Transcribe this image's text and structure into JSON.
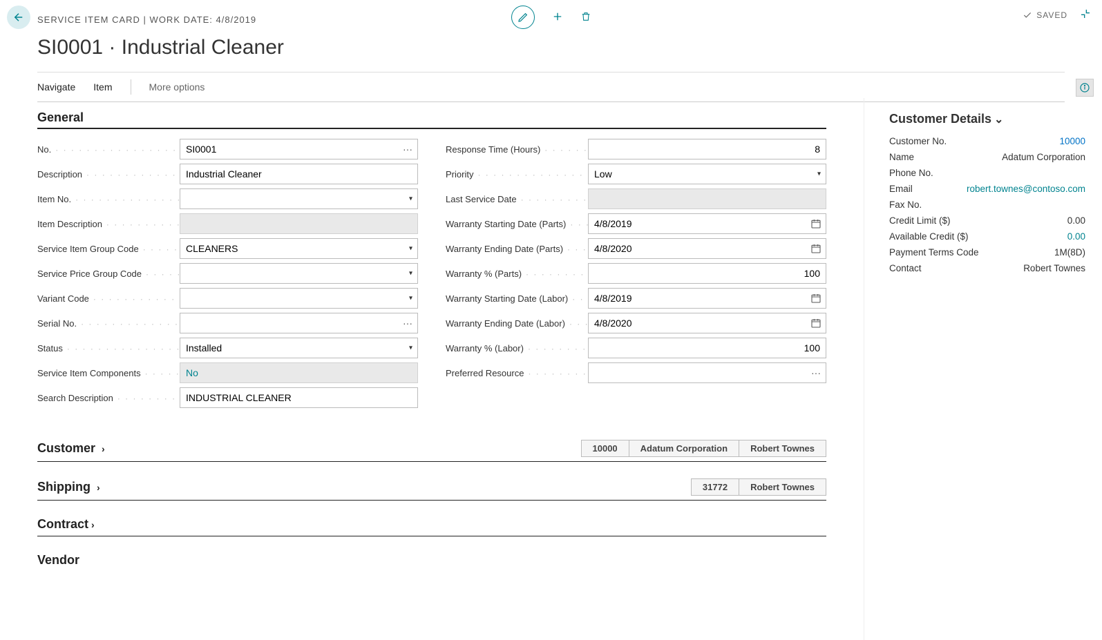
{
  "header": {
    "breadcrumb": "SERVICE ITEM CARD | WORK DATE: 4/8/2019",
    "title": "SI0001 · Industrial Cleaner",
    "saved": "SAVED"
  },
  "actions": {
    "navigate": "Navigate",
    "item": "Item",
    "more": "More options"
  },
  "sections": {
    "general": "General",
    "customer": "Customer",
    "shipping": "Shipping",
    "contract": "Contract",
    "vendor": "Vendor"
  },
  "general": {
    "left": {
      "no_label": "No.",
      "no_value": "SI0001",
      "description_label": "Description",
      "description_value": "Industrial Cleaner",
      "item_no_label": "Item No.",
      "item_no_value": "",
      "item_desc_label": "Item Description",
      "item_desc_value": "",
      "group_label": "Service Item Group Code",
      "group_value": "CLEANERS",
      "price_group_label": "Service Price Group Code",
      "price_group_value": "",
      "variant_label": "Variant Code",
      "variant_value": "",
      "serial_label": "Serial No.",
      "serial_value": "",
      "status_label": "Status",
      "status_value": "Installed",
      "components_label": "Service Item Components",
      "components_value": "No",
      "search_label": "Search Description",
      "search_value": "INDUSTRIAL CLEANER"
    },
    "right": {
      "response_label": "Response Time (Hours)",
      "response_value": "8",
      "priority_label": "Priority",
      "priority_value": "Low",
      "last_service_label": "Last Service Date",
      "last_service_value": "",
      "wsp_label": "Warranty Starting Date (Parts)",
      "wsp_value": "4/8/2019",
      "wep_label": "Warranty Ending Date (Parts)",
      "wep_value": "4/8/2020",
      "wpp_label": "Warranty % (Parts)",
      "wpp_value": "100",
      "wsl_label": "Warranty Starting Date (Labor)",
      "wsl_value": "4/8/2019",
      "wel_label": "Warranty Ending Date (Labor)",
      "wel_value": "4/8/2020",
      "wpl_label": "Warranty % (Labor)",
      "wpl_value": "100",
      "pref_label": "Preferred Resource",
      "pref_value": ""
    }
  },
  "customer_summary": {
    "no": "10000",
    "name": "Adatum Corporation",
    "contact": "Robert Townes"
  },
  "shipping_summary": {
    "code": "31772",
    "contact": "Robert Townes"
  },
  "customer_details": {
    "title": "Customer Details",
    "rows": {
      "customer_no_label": "Customer No.",
      "customer_no_value": "10000",
      "name_label": "Name",
      "name_value": "Adatum Corporation",
      "phone_label": "Phone No.",
      "phone_value": "",
      "email_label": "Email",
      "email_value": "robert.townes@contoso.com",
      "fax_label": "Fax No.",
      "fax_value": "",
      "credit_label": "Credit Limit ($)",
      "credit_value": "0.00",
      "avail_label": "Available Credit ($)",
      "avail_value": "0.00",
      "terms_label": "Payment Terms Code",
      "terms_value": "1M(8D)",
      "contact_label": "Contact",
      "contact_value": "Robert Townes"
    }
  }
}
